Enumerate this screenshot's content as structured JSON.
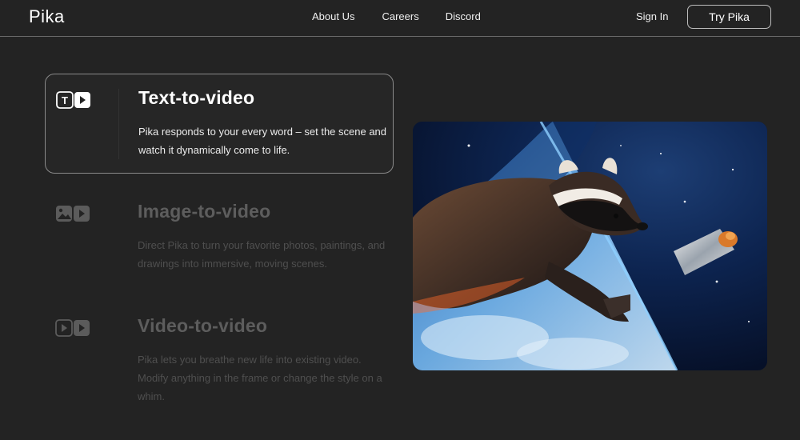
{
  "nav": {
    "logo": "Pika",
    "links": [
      "About Us",
      "Careers",
      "Discord"
    ],
    "sign_in": "Sign In",
    "cta": "Try Pika"
  },
  "features": [
    {
      "title": "Text-to-video",
      "description": "Pika responds to your every word – set the scene and watch it dynamically come to life.",
      "icon": "text-to-video-icon",
      "active": true
    },
    {
      "title": "Image-to-video",
      "description": "Direct Pika to turn your favorite photos, paintings, and drawings into immersive, moving scenes.",
      "icon": "image-to-video-icon",
      "active": false
    },
    {
      "title": "Video-to-video",
      "description": "Pika lets you breathe new life into existing video. Modify anything in the frame or change the style on a whim.",
      "icon": "video-to-video-icon",
      "active": false
    }
  ],
  "hero": {
    "icon": "raccoon-in-space-video"
  },
  "colors": {
    "background": "#232323",
    "border": "#8a8a8a",
    "dim_text": "#5d5d5d"
  }
}
